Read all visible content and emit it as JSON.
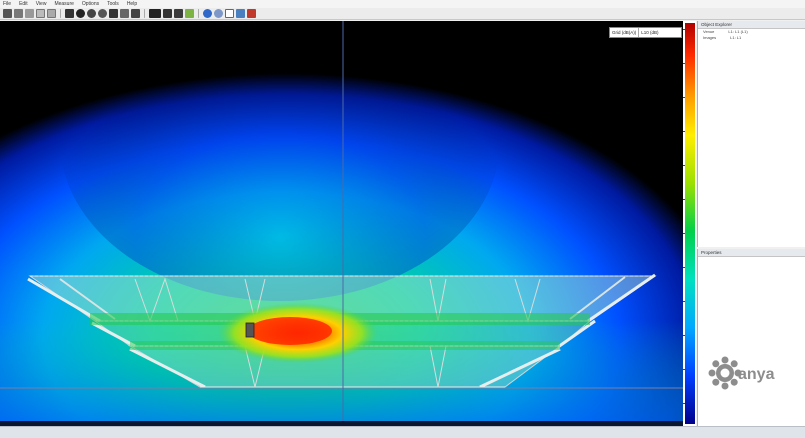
{
  "menu": [
    "File",
    "Edit",
    "View",
    "Measure",
    "Options",
    "Tools",
    "Help"
  ],
  "result_selector": {
    "label": "Grid (dB(A))",
    "value": "L10 (dB)"
  },
  "object_explorer": {
    "title": "Object Explorer",
    "rows": [
      {
        "name": "Venue",
        "value": "L1: L1 (L1)"
      },
      {
        "name": "Images",
        "value": "L1: L1"
      }
    ]
  },
  "properties": {
    "title": "Properties"
  },
  "logo_text": "anya",
  "colors": {
    "accent": "#4a7fc0",
    "logo_grey": "#8d8d8d"
  }
}
